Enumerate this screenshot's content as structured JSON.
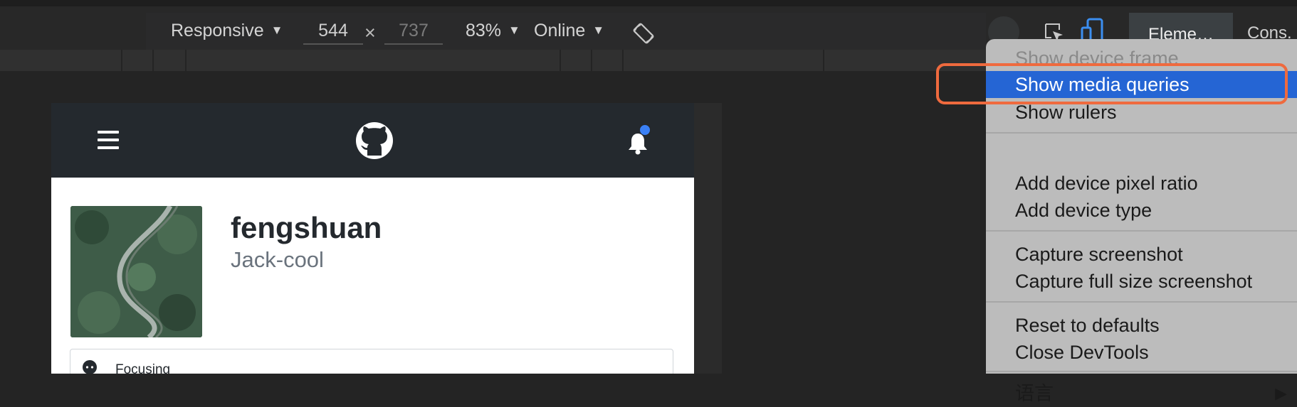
{
  "toolbar": {
    "device": "Responsive",
    "width": "544",
    "times": "×",
    "height": "737",
    "zoom": "83%",
    "network": "Online",
    "caret": "▼"
  },
  "tabs": {
    "elements": "Eleme…",
    "console": "Cons."
  },
  "site": {
    "profile_name": "fengshuan",
    "profile_login": "Jack-cool",
    "status": "Focusing"
  },
  "menu": {
    "show_device_frame": "Show device frame",
    "show_media_queries": "Show media queries",
    "show_rulers": "Show rulers",
    "add_device_pixel_ratio": "Add device pixel ratio",
    "add_device_type": "Add device type",
    "capture_screenshot": "Capture screenshot",
    "capture_full_size_screenshot": "Capture full size screenshot",
    "reset_to_defaults": "Reset to defaults",
    "close_devtools": "Close DevTools",
    "language": "语言",
    "submenu_arrow": "▶"
  },
  "colors": {
    "menu_highlight": "#2565d4",
    "callout_border": "#ef6a3e",
    "notification_dot": "#3a80f6",
    "site_header": "#24292e"
  }
}
